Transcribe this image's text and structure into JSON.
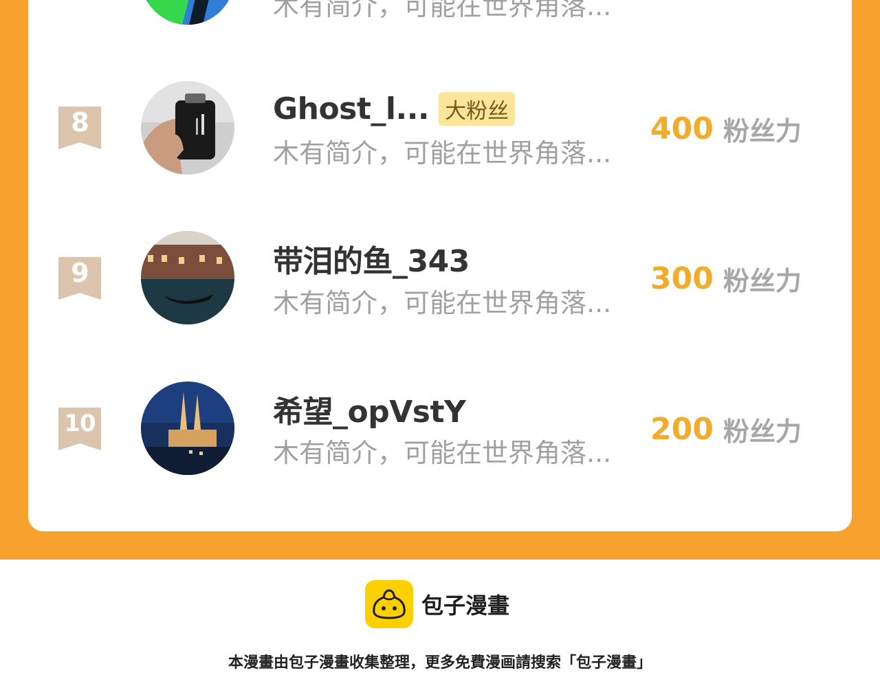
{
  "ranking": {
    "rows": [
      {
        "rank": "",
        "name": "",
        "badge": "",
        "bio": "木有简介，可能在世界角落...",
        "score": "",
        "unit": ""
      },
      {
        "rank": "8",
        "name": "Ghost_l...",
        "badge": "大粉丝",
        "bio": "木有简介，可能在世界角落...",
        "score": "400",
        "unit": "粉丝力"
      },
      {
        "rank": "9",
        "name": "带泪的鱼_343",
        "badge": "",
        "bio": "木有简介，可能在世界角落...",
        "score": "300",
        "unit": "粉丝力"
      },
      {
        "rank": "10",
        "name": "希望_opVstY",
        "badge": "",
        "bio": "木有简介，可能在世界角落...",
        "score": "200",
        "unit": "粉丝力"
      }
    ]
  },
  "brand": {
    "name": "包子漫畫"
  },
  "footer": {
    "text": "本漫畫由包子漫畫收集整理，更多免費漫画請搜索「包子漫畫」"
  },
  "colors": {
    "accent_orange": "#f7a12e",
    "score_gold": "#f2ac2a",
    "badge_bg": "#fbe59b",
    "rank_tag": "#dcc4ad"
  }
}
